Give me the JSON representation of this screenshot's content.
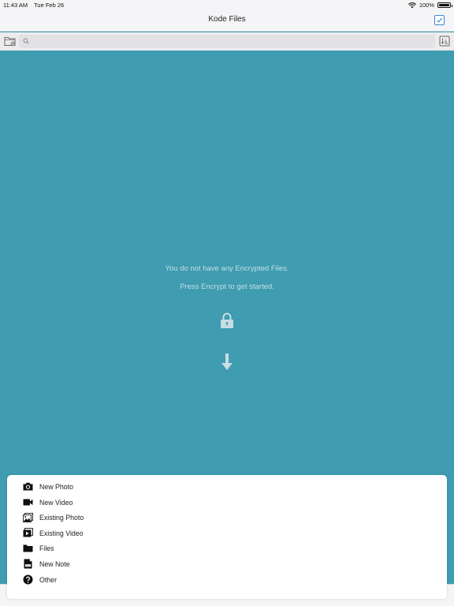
{
  "status_bar": {
    "time": "11:43 AM",
    "date": "Tue Feb 26",
    "battery": "100%",
    "battery_level": 1.0
  },
  "nav": {
    "title": "Kode Files"
  },
  "search": {
    "placeholder": "",
    "value": ""
  },
  "empty_state": {
    "line1": "You do not have any Encrypted Files.",
    "line2": "Press Encrypt to get started."
  },
  "action_sheet": {
    "items": [
      {
        "label": "New Photo",
        "icon": "camera-icon"
      },
      {
        "label": "New Video",
        "icon": "video-camera-icon"
      },
      {
        "label": "Existing Photo",
        "icon": "photo-library-icon"
      },
      {
        "label": "Existing Video",
        "icon": "video-library-icon"
      },
      {
        "label": "Files",
        "icon": "folder-icon"
      },
      {
        "label": "New Note",
        "icon": "text-note-icon"
      },
      {
        "label": "Other",
        "icon": "question-icon"
      }
    ]
  },
  "colors": {
    "background": "#3f9cb1",
    "accent": "#3b86d8",
    "sheet": "#ffffff"
  }
}
